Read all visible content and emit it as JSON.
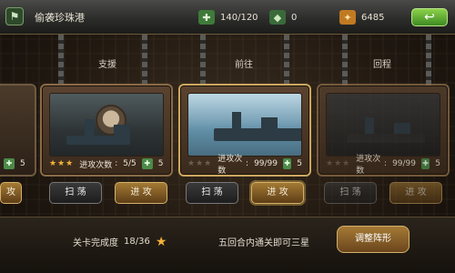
{
  "topbar": {
    "title": "偷袭珍珠港",
    "energy": "140/120",
    "gems": "0",
    "coins": "6485",
    "flag_icon": "flag-icon",
    "back_icon": "back-arrow-icon"
  },
  "sections": [
    "支援",
    "前往",
    "回程"
  ],
  "missions": [
    {
      "stars": "★★★",
      "attack_count_label": "进攻次数",
      "attack_count": "5/5",
      "reward": "5",
      "sweep": "扫 荡",
      "attack": "进 攻"
    },
    {
      "stars": "★★★",
      "attack_count_label": "进攻次数",
      "attack_count": "99/99",
      "reward": "5",
      "sweep": "扫 荡",
      "attack": "进 攻"
    },
    {
      "stars": "★★★",
      "attack_count_label": "进攻次数",
      "attack_count": "99/99",
      "reward": "5",
      "sweep": "扫 荡",
      "attack": "进 攻"
    }
  ],
  "left_partial": {
    "reward": "5",
    "attack": "攻"
  },
  "bottom": {
    "progress_label": "关卡完成度",
    "progress_value": "18/36",
    "hint": "五回合内通关即可三星",
    "formation": "调整阵形"
  }
}
